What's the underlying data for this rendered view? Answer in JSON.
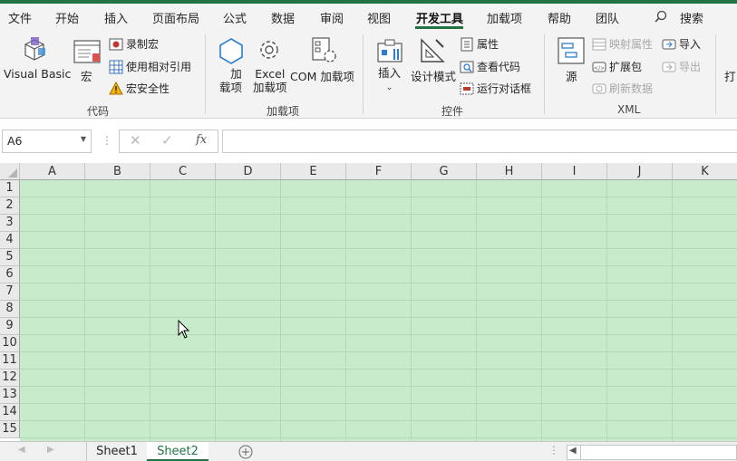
{
  "menu": {
    "tabs": [
      "文件",
      "开始",
      "插入",
      "页面布局",
      "公式",
      "数据",
      "审阅",
      "视图",
      "开发工具",
      "加载项",
      "帮助",
      "团队"
    ],
    "active_tab": "开发工具",
    "search_label": "搜索"
  },
  "ribbon": {
    "code": {
      "label": "代码",
      "visual_basic": "Visual Basic",
      "macros": "宏",
      "record_macro": "录制宏",
      "use_relative": "使用相对引用",
      "macro_security": "宏安全性"
    },
    "addins": {
      "label": "加载项",
      "addins_line1": "加",
      "addins_line2": "载项",
      "excel_line1": "Excel",
      "excel_line2": "加载项",
      "com_addins": "COM 加载项"
    },
    "controls": {
      "label": "控件",
      "insert": "插入",
      "design_mode": "设计模式",
      "properties": "属性",
      "view_code": "查看代码",
      "run_dialog": "运行对话框"
    },
    "xml": {
      "label": "XML",
      "source": "源",
      "map_properties": "映射属性",
      "expansion_packs": "扩展包",
      "refresh_data": "刷新数据",
      "import": "导入",
      "export": "导出"
    },
    "overflow_label": "打"
  },
  "formula_bar": {
    "name_box": "A6",
    "fx": "fx",
    "value": ""
  },
  "grid": {
    "columns": [
      "A",
      "B",
      "C",
      "D",
      "E",
      "F",
      "G",
      "H",
      "I",
      "J",
      "K"
    ],
    "rows": [
      "1",
      "2",
      "3",
      "4",
      "5",
      "6",
      "7",
      "8",
      "9",
      "10",
      "11",
      "12",
      "13",
      "14",
      "15"
    ],
    "fill_color": "#c8ebcc"
  },
  "sheets": {
    "tabs": [
      "Sheet1",
      "Sheet2"
    ],
    "active": "Sheet2"
  },
  "colors": {
    "accent": "#217346"
  }
}
